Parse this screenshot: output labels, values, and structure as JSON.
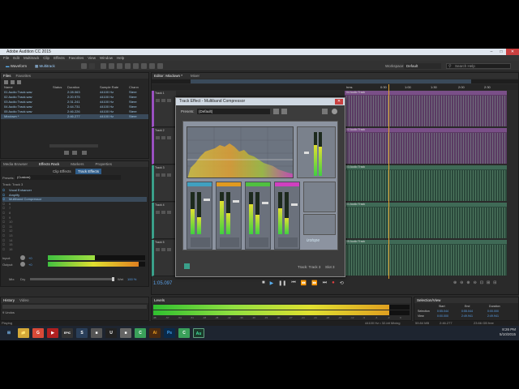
{
  "window": {
    "title": "Adobe Audition CC 2015",
    "buttons": [
      "–",
      "□",
      "✕"
    ]
  },
  "menu": [
    "File",
    "Edit",
    "Multitrack",
    "Clip",
    "Effects",
    "Favorites",
    "View",
    "Window",
    "Help"
  ],
  "toolbar": {
    "waveform_label": "Waveform",
    "multitrack_label": "Multitrack",
    "workspace_label": "Workspace:",
    "workspace_value": "Default",
    "search_placeholder": "Search Help"
  },
  "files_panel": {
    "tabs": [
      "Files",
      "Favorites"
    ],
    "columns": [
      "Name",
      "Status",
      "Duration",
      "Sample Rate",
      "Chann"
    ],
    "rows": [
      {
        "name": "01 Audio Track.wav",
        "duration": "2:28.063",
        "rate": "44100 Hz",
        "ch": "Stere"
      },
      {
        "name": "02 Audio Track.wav",
        "duration": "2:20.975",
        "rate": "44100 Hz",
        "ch": "Stere"
      },
      {
        "name": "03 Audio Track.wav",
        "duration": "2:31.241",
        "rate": "44100 Hz",
        "ch": "Stere"
      },
      {
        "name": "04 Audio Track.wav",
        "duration": "2:44.731",
        "rate": "44100 Hz",
        "ch": "Stere"
      },
      {
        "name": "05 Audio Track.wav",
        "duration": "2:46.226",
        "rate": "44100 Hz",
        "ch": "Stere"
      },
      {
        "name": "Mixdown *",
        "duration": "2:46.277",
        "rate": "44100 Hz",
        "ch": "Stere"
      }
    ]
  },
  "effects_panel": {
    "tabs": [
      "Media Browser",
      "Effects Rack",
      "Markers",
      "Properties"
    ],
    "subtabs": [
      "Clip Effects",
      "Track Effects"
    ],
    "presets_label": "Presets:",
    "presets_value": "(Custom)",
    "track_label": "Track: Track 3",
    "slots": [
      "Vocal Enhancer",
      "Amplify",
      "Multiband Compressor",
      "6",
      "7",
      "8",
      "9",
      "10",
      "11",
      "12",
      "13",
      "14",
      "15",
      "16"
    ],
    "input_label": "Input:",
    "output_label": "Output:",
    "input_value": "+0",
    "output_value": "+0",
    "mix_label": "Mix:",
    "mix_dry": "Dry",
    "mix_wet": "Wet",
    "mix_value": "100 %"
  },
  "history_panel": {
    "tabs": [
      "History",
      "Video"
    ],
    "undo_label": "9 Undos",
    "status": "Playing"
  },
  "editor": {
    "tab_label": "Editor: Mixdown *",
    "tab_secondary": "Mixer",
    "ruler": [
      "hms",
      "0:30",
      "1:00",
      "1:30",
      "2:00",
      "2:30"
    ],
    "time_display": "1:05.097"
  },
  "tracks": [
    {
      "name": "Track 1",
      "clip": "04 Audio Track"
    },
    {
      "name": "Track 2",
      "clip": "02 Audio Track"
    },
    {
      "name": "Track 3",
      "clip": "03 Audio Track"
    },
    {
      "name": "Track 4",
      "clip": "01 Audio Track"
    },
    {
      "name": "Track 5",
      "clip": "05 Audio Track"
    }
  ],
  "dialog": {
    "title": "Track Effect - Multiband Compressor",
    "presets_label": "Presets:",
    "presets_value": "(Default)",
    "footer_track": "Track: Track 3",
    "footer_slot": "Slot 3",
    "brand": "izotope"
  },
  "levels_panel": {
    "title": "Levels",
    "scale": [
      "dB",
      "-57",
      "-54",
      "-51",
      "-48",
      "-45",
      "-42",
      "-39",
      "-36",
      "-33",
      "-30",
      "-27",
      "-24",
      "-21",
      "-18",
      "-15",
      "-12",
      "-9",
      "-6",
      "-3",
      "0"
    ],
    "level": 0.92
  },
  "selection_panel": {
    "title": "Selection/View",
    "columns": [
      "Start",
      "End",
      "Duration"
    ],
    "rows": [
      {
        "label": "Selection",
        "start": "0:55.044",
        "end": "0:55.044",
        "duration": "0:00.000"
      },
      {
        "label": "View",
        "start": "0:00.000",
        "end": "2:49.941",
        "duration": "2:49.941"
      }
    ]
  },
  "status_bar": {
    "format": "44100 Hz • 32-bit Mixing",
    "size": "59.84 MB",
    "duration": "2:46.277",
    "free": "23.66 GB free"
  },
  "taskbar": {
    "apps": [
      "⊞",
      "📁",
      "G",
      "▶",
      "EPIC",
      "S",
      "■",
      "U",
      "■",
      "C",
      "Ai",
      "Ps",
      "C",
      "Au"
    ],
    "clock_time": "8:26 PM",
    "clock_date": "5/10/2015"
  },
  "colors": {
    "accent": "#3a8fd9",
    "clip_purple": "#5a3b63",
    "clip_green": "#2b4a3c",
    "band_orange": "#e09a20",
    "band_green": "#50c040",
    "band_pink": "#d040c0",
    "band_cyan": "#40a0c0"
  }
}
